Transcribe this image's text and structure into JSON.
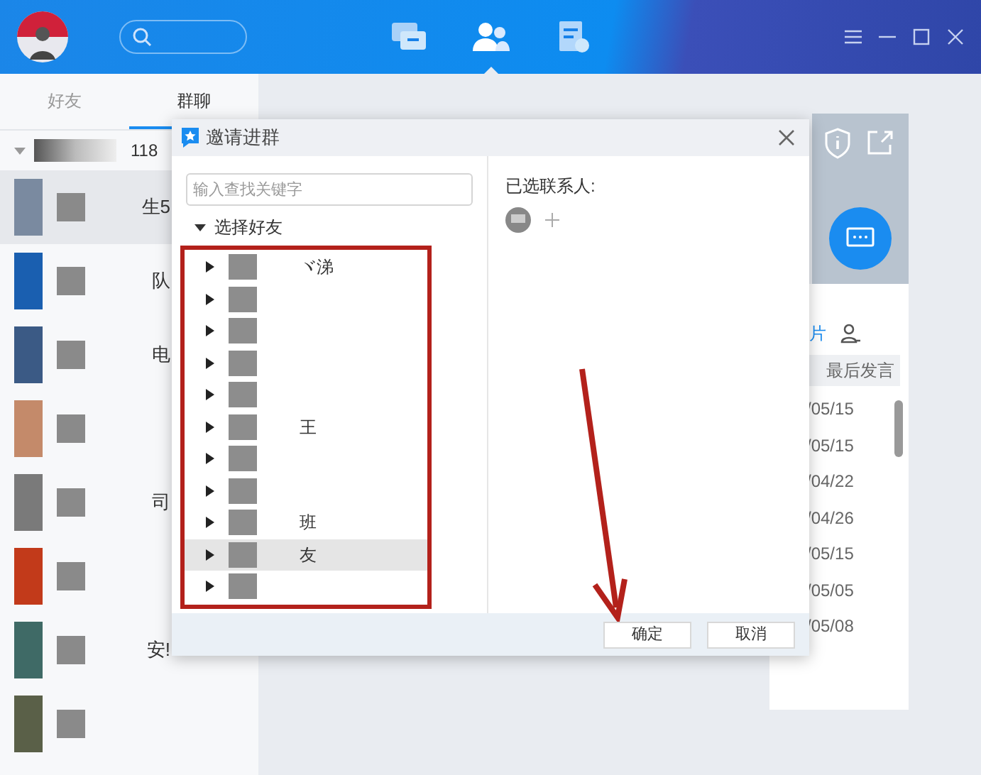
{
  "top_bar": {
    "nav": [
      {
        "kind": "chat",
        "selected": false
      },
      {
        "kind": "contacts",
        "selected": true
      },
      {
        "kind": "docs",
        "selected": false
      }
    ]
  },
  "sidebar": {
    "tabs": [
      {
        "label": "好友",
        "selected": false
      },
      {
        "label": "群聊",
        "selected": true
      }
    ],
    "group_header": {
      "count": "118",
      "expanded": true
    },
    "items": [
      {
        "text": "生5",
        "color": "#7a8aa0"
      },
      {
        "text": "队",
        "color": "#1a5fb0"
      },
      {
        "text": "电",
        "color": "#3b5a85"
      },
      {
        "color": "#c48a6a"
      },
      {
        "text": "司",
        "color": "#7a7a7a"
      },
      {
        "color": "#c23a1a"
      },
      {
        "text": "安!",
        "color": "#3f6a66"
      },
      {
        "color": "#5a6048"
      }
    ]
  },
  "dialog": {
    "title": "邀请进群",
    "search": {
      "placeholder": "输入查找关键字"
    },
    "tree": {
      "label": "选择好友",
      "expanded": true,
      "children": [
        {
          "label": "ヾ涕",
          "expanded": false,
          "selected": false
        },
        {
          "expanded": false,
          "selected": false
        },
        {
          "expanded": false,
          "selected": false
        },
        {
          "expanded": false,
          "selected": false
        },
        {
          "expanded": false,
          "selected": false
        },
        {
          "label": "王",
          "expanded": false,
          "selected": false
        },
        {
          "expanded": false,
          "selected": false
        },
        {
          "expanded": false,
          "selected": false
        },
        {
          "label": "班",
          "expanded": false,
          "selected": false
        },
        {
          "label": "友",
          "expanded": false,
          "selected": true
        },
        {
          "expanded": false,
          "selected": false
        }
      ]
    },
    "selected_title": "已选联系人:",
    "buttons": [
      "确定",
      "取消"
    ]
  },
  "group_panel": {
    "tab_fragment": "片",
    "column_header": "最后发言",
    "dates": [
      "/05/15",
      "/05/15",
      "/04/22",
      "/04/26",
      "/05/15",
      "/05/05",
      "/05/08"
    ]
  }
}
